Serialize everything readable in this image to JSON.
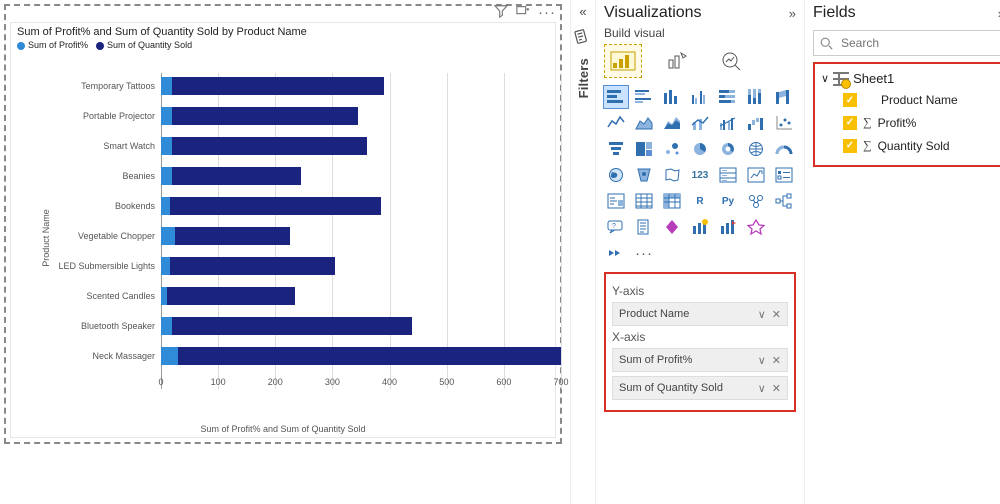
{
  "chart": {
    "title": "Sum of Profit% and Sum of Quantity Sold by Product Name",
    "legend": {
      "series1": {
        "label": "Sum of Profit%",
        "color": "#2f8ad8"
      },
      "series2": {
        "label": "Sum of Quantity Sold",
        "color": "#1a237e"
      }
    },
    "ylabel": "Product Name",
    "xlabel": "Sum of Profit% and Sum of Quantity Sold",
    "ticks": [
      0,
      100,
      200,
      300,
      400,
      500,
      600,
      700
    ],
    "toolbar": {
      "filter": "filter",
      "focus": "focus",
      "more": "…"
    }
  },
  "chart_data": {
    "type": "bar",
    "orientation": "horizontal",
    "categories": [
      "Temporary Tattoos",
      "Portable Projector",
      "Smart Watch",
      "Beanies",
      "Bookends",
      "Vegetable Chopper",
      "LED Submersible Lights",
      "Scented Candles",
      "Bluetooth Speaker",
      "Neck Massager"
    ],
    "series": [
      {
        "name": "Sum of Profit%",
        "color": "#2f8ad8",
        "values": [
          20,
          20,
          20,
          20,
          15,
          25,
          15,
          10,
          20,
          30
        ]
      },
      {
        "name": "Sum of Quantity Sold",
        "color": "#1a237e",
        "values": [
          370,
          325,
          340,
          225,
          370,
          200,
          290,
          225,
          420,
          670
        ]
      }
    ],
    "xlabel": "Sum of Profit% and Sum of Quantity Sold",
    "ylabel": "Product Name",
    "xlim": [
      0,
      700
    ]
  },
  "filters": {
    "label": "Filters"
  },
  "vis": {
    "title": "Visualizations",
    "build": "Build visual",
    "yaxis_label": "Y-axis",
    "xaxis_label": "X-axis",
    "wells": {
      "y0": "Product Name",
      "x0": "Sum of Profit%",
      "x1": "Sum of Quantity Sold"
    }
  },
  "fields": {
    "title": "Fields",
    "search_placeholder": "Search",
    "table": "Sheet1",
    "f0": "Product Name",
    "f1": "Profit%",
    "f2": "Quantity Sold"
  }
}
